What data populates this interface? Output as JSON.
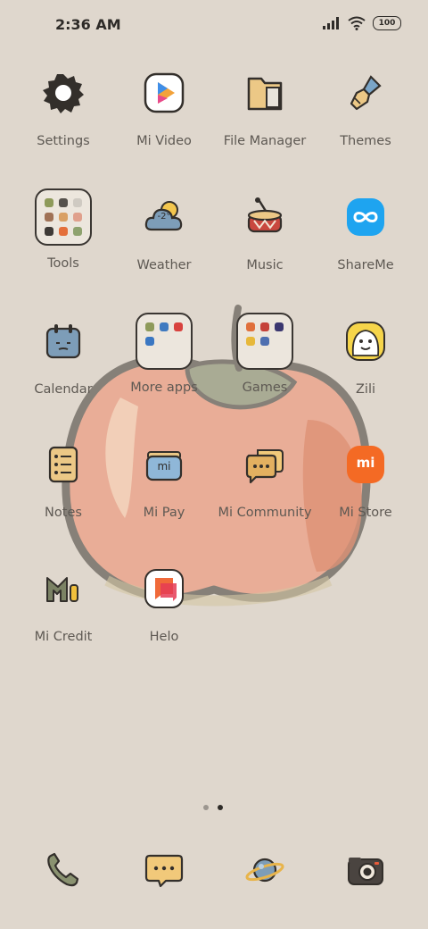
{
  "status_bar": {
    "time": "2:36 AM",
    "battery": "100"
  },
  "apps": {
    "settings": "Settings",
    "mi_video": "Mi Video",
    "file_manager": "File Manager",
    "themes": "Themes",
    "tools": "Tools",
    "weather": "Weather",
    "weather_temp": "-2°",
    "music": "Music",
    "shareme": "ShareMe",
    "calendar": "Calendar",
    "more_apps": "More apps",
    "games": "Games",
    "zili": "Zili",
    "notes": "Notes",
    "mi_pay": "Mi Pay",
    "mi_pay_mark": "mi",
    "mi_community": "Mi Community",
    "mi_store": "Mi Store",
    "mi_store_mark": "mi",
    "mi_credit": "Mi Credit",
    "helo": "Helo"
  },
  "page_indicator": {
    "pages": 2,
    "current": 2
  },
  "dock": [
    "phone-icon",
    "messages-icon",
    "browser-icon",
    "camera-icon"
  ],
  "colors": {
    "background": "#dfd7cd",
    "apple": "#e6a48d",
    "label": "#5e5953"
  }
}
